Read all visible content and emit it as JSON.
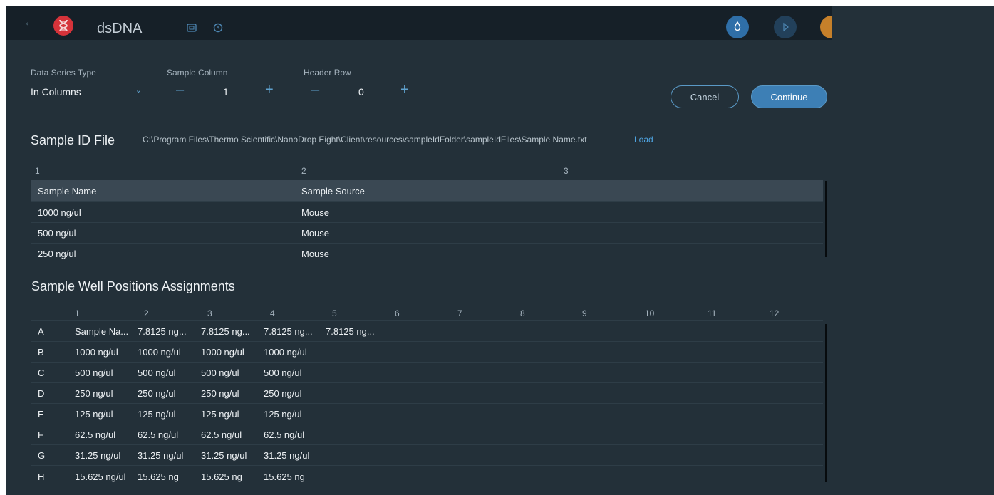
{
  "titlebar": {
    "title": "dsDNA",
    "back_icon": "back-arrow-icon",
    "logo_icon": "dna-logo-icon",
    "icons": [
      "id-card-icon",
      "history-icon"
    ],
    "right_icons": [
      "droplet-icon",
      "play-icon",
      "user-icon"
    ],
    "colors": {
      "bar": "#162028",
      "logo": "#d5333a",
      "accent": "#3d7fb5",
      "orange": "#c6802a"
    }
  },
  "settings": {
    "data_series_type": {
      "label": "Data Series Type",
      "value": "In Columns"
    },
    "sample_column": {
      "label": "Sample Column",
      "value": "1"
    },
    "header_row": {
      "label": "Header Row",
      "value": "0"
    },
    "cancel_label": "Cancel",
    "continue_label": "Continue"
  },
  "sample_id_file": {
    "title": "Sample ID File",
    "path": "C:\\Program Files\\Thermo Scientific\\NanoDrop Eight\\Client\\resources\\sampleIdFolder\\sampleIdFiles\\Sample Name.txt",
    "load_label": "Load",
    "column_numbers": [
      "1",
      "2",
      "3"
    ],
    "rows": [
      [
        "Sample Name",
        "Sample Source",
        ""
      ],
      [
        "1000 ng/ul",
        "Mouse",
        ""
      ],
      [
        "500 ng/ul",
        "Mouse",
        ""
      ],
      [
        "250 ng/ul",
        "Mouse",
        ""
      ]
    ]
  },
  "wells": {
    "title": "Sample Well Positions Assignments",
    "columns": [
      "1",
      "2",
      "3",
      "4",
      "5",
      "6",
      "7",
      "8",
      "9",
      "10",
      "11",
      "12"
    ],
    "rows": [
      {
        "label": "A",
        "cells": [
          "Sample Na...",
          "7.8125 ng...",
          "7.8125 ng...",
          "7.8125 ng...",
          "7.8125 ng..."
        ]
      },
      {
        "label": "B",
        "cells": [
          "1000 ng/ul",
          "1000 ng/ul",
          "1000 ng/ul",
          "1000 ng/ul"
        ]
      },
      {
        "label": "C",
        "cells": [
          "500 ng/ul",
          "500 ng/ul",
          "500 ng/ul",
          "500 ng/ul"
        ]
      },
      {
        "label": "D",
        "cells": [
          "250 ng/ul",
          "250 ng/ul",
          "250 ng/ul",
          "250 ng/ul"
        ]
      },
      {
        "label": "E",
        "cells": [
          "125 ng/ul",
          "125 ng/ul",
          "125 ng/ul",
          "125 ng/ul"
        ]
      },
      {
        "label": "F",
        "cells": [
          "62.5 ng/ul",
          "62.5 ng/ul",
          "62.5 ng/ul",
          "62.5 ng/ul"
        ]
      },
      {
        "label": "G",
        "cells": [
          "31.25 ng/ul",
          "31.25 ng/ul",
          "31.25 ng/ul",
          "31.25 ng/ul"
        ]
      },
      {
        "label": "H",
        "cells": [
          "15.625 ng/ul",
          "15.625 ng",
          "15.625 ng",
          "15.625 ng"
        ]
      }
    ]
  }
}
